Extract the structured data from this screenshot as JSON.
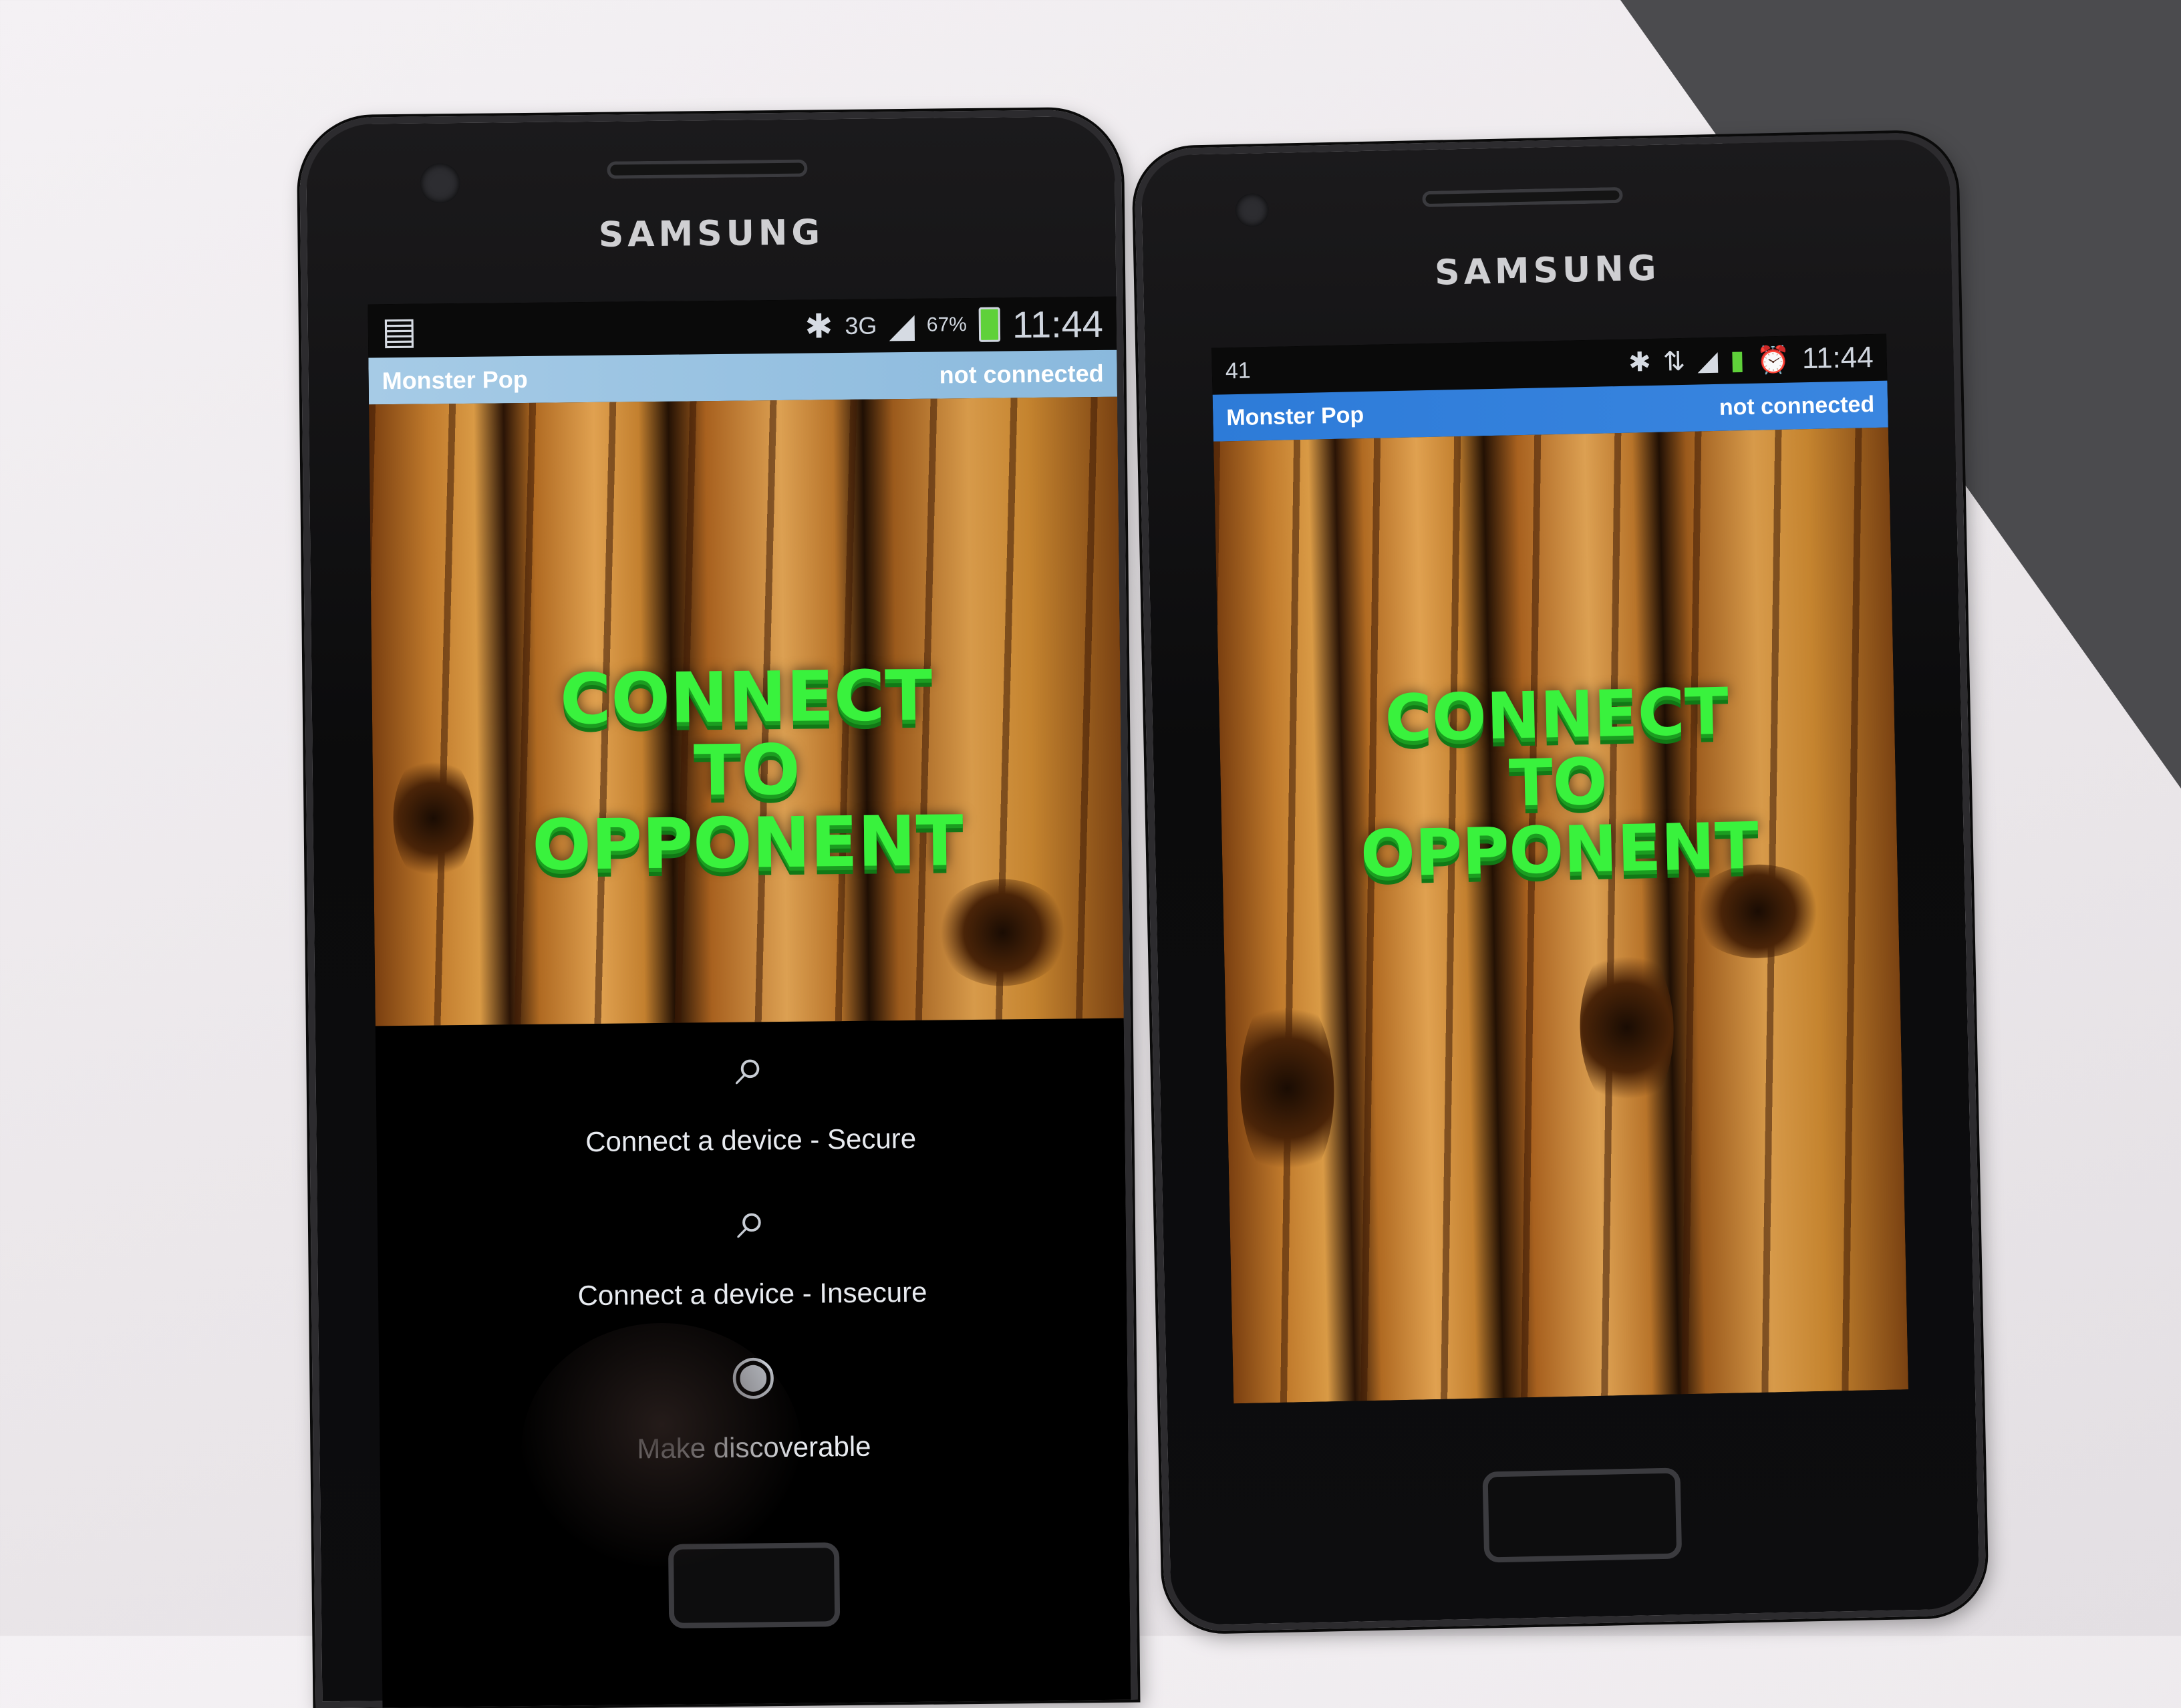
{
  "left_phone": {
    "brand": "SAMSUNG",
    "status": {
      "clock": "11:44",
      "battery": "67%",
      "network": "3G"
    },
    "app_title": "Monster Pop",
    "connection_status": "not connected",
    "headline": [
      "CONNECT",
      "TO",
      "OPPONENT"
    ],
    "menu": [
      {
        "label": "Connect a device - Secure",
        "icon": "search-icon"
      },
      {
        "label": "Connect a device - Insecure",
        "icon": "search-icon"
      },
      {
        "label": "Make discoverable",
        "icon": "discoverable-icon"
      }
    ]
  },
  "right_phone": {
    "brand": "SAMSUNG",
    "status": {
      "clock": "11:44",
      "left_indicator": "41"
    },
    "app_title": "Monster Pop",
    "connection_status": "not connected",
    "headline": [
      "CONNECT",
      "TO",
      "OPPONENT"
    ]
  },
  "colors": {
    "headline": "#39f23d",
    "titlebar_left": "#a6cbe6",
    "titlebar_right": "#2d7bd8",
    "battery": "#5fd13a"
  }
}
